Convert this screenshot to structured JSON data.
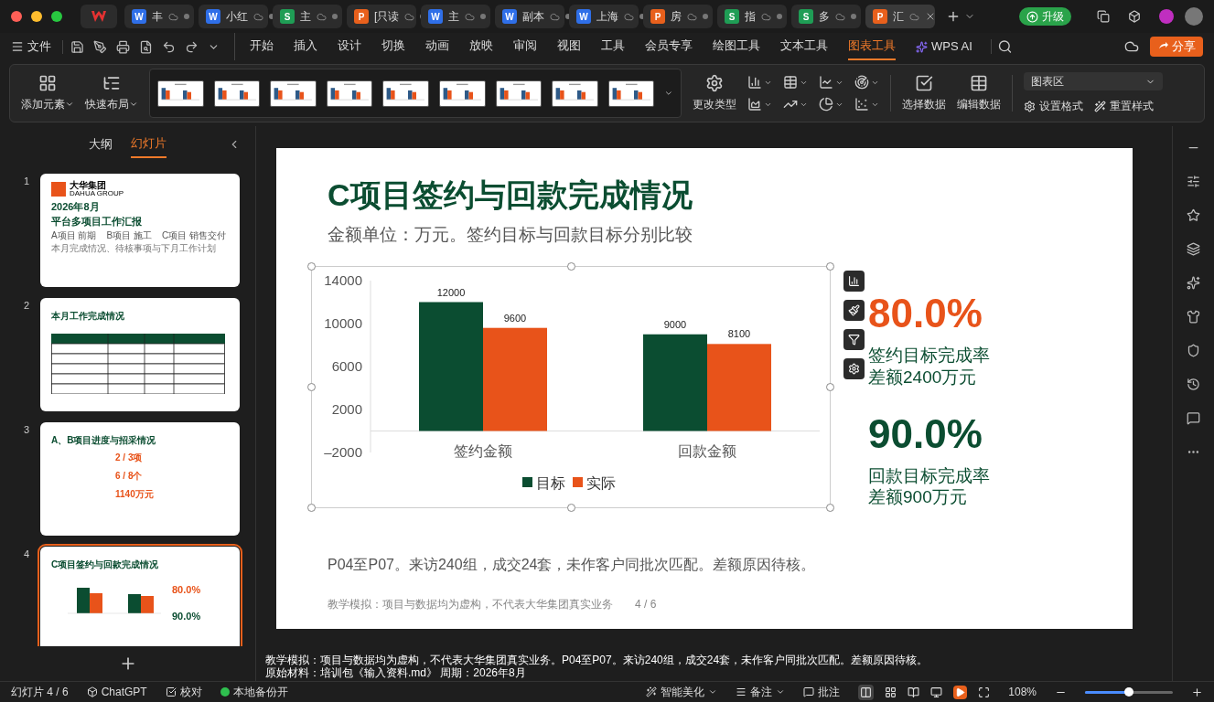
{
  "tabs": [
    {
      "badge": "W",
      "color": "#2f6fe8",
      "title": "丰",
      "selected": false
    },
    {
      "badge": "W",
      "color": "#2f6fe8",
      "title": "小红",
      "selected": false
    },
    {
      "badge": "S",
      "color": "#1f9d55",
      "title": "主",
      "selected": false
    },
    {
      "badge": "P",
      "color": "#e8601c",
      "title": "[只读",
      "selected": false
    },
    {
      "badge": "W",
      "color": "#2f6fe8",
      "title": "主",
      "selected": false
    },
    {
      "badge": "W",
      "color": "#2f6fe8",
      "title": "副本",
      "selected": false
    },
    {
      "badge": "W",
      "color": "#2f6fe8",
      "title": "上海",
      "selected": false
    },
    {
      "badge": "P",
      "color": "#e8601c",
      "title": "房",
      "selected": false
    },
    {
      "badge": "S",
      "color": "#1f9d55",
      "title": "指",
      "selected": false
    },
    {
      "badge": "S",
      "color": "#1f9d55",
      "title": "多",
      "selected": false
    },
    {
      "badge": "P",
      "color": "#e8601c",
      "title": "汇",
      "selected": true
    }
  ],
  "upgrade_button": "升级",
  "file_menu": "文件",
  "menu_tabs": [
    {
      "label": "开始",
      "selected": false
    },
    {
      "label": "插入",
      "selected": false
    },
    {
      "label": "设计",
      "selected": false
    },
    {
      "label": "切换",
      "selected": false
    },
    {
      "label": "动画",
      "selected": false
    },
    {
      "label": "放映",
      "selected": false
    },
    {
      "label": "审阅",
      "selected": false
    },
    {
      "label": "视图",
      "selected": false
    },
    {
      "label": "工具",
      "selected": false
    },
    {
      "label": "会员专享",
      "selected": false
    },
    {
      "label": "绘图工具",
      "selected": false
    },
    {
      "label": "文本工具",
      "selected": false
    },
    {
      "label": "图表工具",
      "selected": true
    }
  ],
  "wps_ai": "WPS AI",
  "share_button": "分享",
  "ribbon": {
    "add_element": "添加元素",
    "quick_layout": "快速布局",
    "change_type": "更改类型",
    "select_data": "选择数据",
    "edit_data": "编辑数据",
    "element_select": "图表区",
    "format": "设置格式",
    "reset_style": "重置样式"
  },
  "panel": {
    "outline_tab": {
      "label": "大纲",
      "selected": false
    },
    "slides_tab": {
      "label": "幻灯片",
      "selected": true
    }
  },
  "slides": [
    {
      "number": "1",
      "kind": "cover",
      "selected": false,
      "logo": "大华集团",
      "logo_sub": "DAHUA GROUP",
      "title": "2026年8月",
      "subtitle": "平台多项目工作汇报",
      "tags": "A项目 前期    B项目 施工    C项目 销售交付",
      "note": "本月完成情况、待核事项与下月工作计划"
    },
    {
      "number": "2",
      "kind": "table",
      "selected": false,
      "title": "本月工作完成情况"
    },
    {
      "number": "3",
      "kind": "progress",
      "selected": false,
      "title": "A、B项目进度与招采情况",
      "items": [
        {
          "value": "2 / 3项"
        },
        {
          "value": "6 / 8个"
        },
        {
          "value": "1140万元"
        }
      ]
    },
    {
      "number": "4",
      "kind": "chart",
      "selected": true,
      "title": "C项目签约与回款完成情况",
      "stat1": "80.0%",
      "stat2": "90.0%"
    }
  ],
  "slide": {
    "title": "C项目签约与回款完成情况",
    "subtitle": "金额单位：万元。签约目标与回款目标分别比较",
    "chart_data": {
      "type": "bar",
      "categories": [
        "签约金额",
        "回款金额"
      ],
      "series": [
        {
          "name": "目标",
          "color": "#0b4d31",
          "values": [
            12000,
            9000
          ]
        },
        {
          "name": "实际",
          "color": "#e8531a",
          "values": [
            9600,
            8100
          ]
        }
      ],
      "ylim": [
        -2000,
        14000
      ],
      "yticks": [
        {
          "value": 14000,
          "label": "14000"
        },
        {
          "value": 10000,
          "label": "10000"
        },
        {
          "value": 6000,
          "label": "6000"
        },
        {
          "value": 2000,
          "label": "2000"
        },
        {
          "value": -2000,
          "label": "–2000"
        }
      ],
      "data_labels": true,
      "legend": true
    },
    "stats": [
      {
        "value": "80.0%",
        "color": "#e8531a",
        "label": "签约目标完成率",
        "diff": "差额2400万元"
      },
      {
        "value": "90.0%",
        "color": "#0b4d31",
        "label": "回款目标完成率",
        "diff": "差额900万元"
      }
    ],
    "note": "P04至P07。来访240组，成交24套，未作客户同批次匹配。差额原因待核。",
    "footer": "教学模拟：项目与数据均为虚构，不代表大华集团真实业务",
    "page": "4 / 6"
  },
  "notes": [
    "教学模拟：项目与数据均为虚构，不代表大华集团真实业务。P04至P07。来访240组，成交24套，未作客户同批次匹配。差额原因待核。",
    "原始材料：培训包《输入资料.md》  周期：2026年8月"
  ],
  "status": {
    "slide_counter": "幻灯片 4 / 6",
    "chatgpt": "ChatGPT",
    "proofread": "校对",
    "backup": "本地备份开",
    "beautify": "智能美化",
    "notes": "备注",
    "comments": "批注",
    "zoom": "108%",
    "zoom_slider": {
      "level": 0.5
    }
  }
}
